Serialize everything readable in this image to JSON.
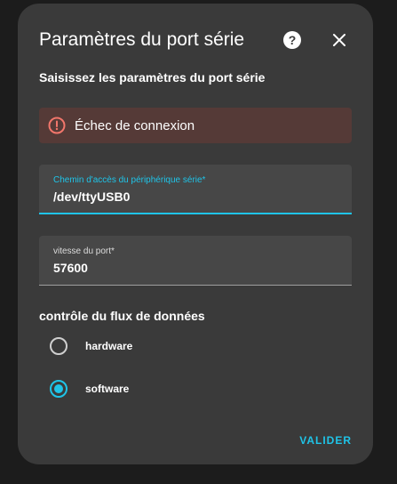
{
  "dialog": {
    "title": "Paramètres du port série",
    "subtitle": "Saisissez les paramètres du port série",
    "help_icon": "help-circle-icon",
    "close_icon": "close-icon"
  },
  "alert": {
    "icon": "alert-circle-outline-icon",
    "text": "Échec de connexion",
    "color": "#553a37"
  },
  "fields": {
    "device_path": {
      "label": "Chemin d'accès du périphérique série*",
      "value": "/dev/ttyUSB0"
    },
    "port_speed": {
      "label": "vitesse du port*",
      "value": "57600"
    }
  },
  "flow_control": {
    "title": "contrôle du flux de données",
    "options": [
      {
        "label": "hardware",
        "selected": false
      },
      {
        "label": "software",
        "selected": true
      }
    ]
  },
  "actions": {
    "submit_label": "VALIDER"
  },
  "colors": {
    "accent": "#1fc4e8",
    "dialog_bg": "#3a3a3a",
    "error": "#f2766b"
  }
}
